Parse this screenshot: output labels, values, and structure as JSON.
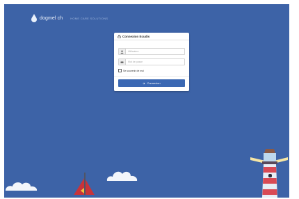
{
  "brand": {
    "name": "dogmel",
    "dot": ".",
    "suffix": "ch",
    "tagline": "HOME CARE SOLUTIONS"
  },
  "login": {
    "title": "Connexion Ecudis",
    "username_placeholder": "Utilisateur",
    "password_placeholder": "Mot de passe",
    "remember_label": "Se souvenir de moi",
    "submit_label": "Connexion"
  },
  "colors": {
    "background": "#3d63a7",
    "button": "#3b68b3",
    "accent": "#e0342b"
  },
  "icons": [
    "drop-logo",
    "lock-icon",
    "user-icon",
    "key-icon",
    "login-arrow-icon"
  ]
}
